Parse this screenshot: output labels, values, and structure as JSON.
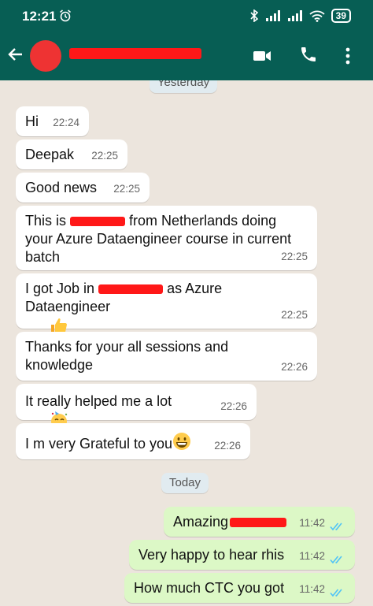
{
  "status_bar": {
    "time": "12:21",
    "battery": "39"
  },
  "header": {
    "contact_name": ""
  },
  "chat": {
    "date_yesterday": "Yesterday",
    "date_today": "Today",
    "messages": [
      {
        "text": "Hi",
        "time": "22:24"
      },
      {
        "text": "Deepak",
        "time": "22:25"
      },
      {
        "text": "Good news",
        "time": "22:25"
      },
      {
        "text_a": "This is",
        "text_b": "from Netherlands doing your Azure Dataengineer course in current batch",
        "time": "22:25"
      },
      {
        "text_a": "I got Job in",
        "text_b": "as Azure Dataengineer",
        "time": "22:25"
      },
      {
        "text": "Thanks for your all sessions and knowledge",
        "time": "22:26"
      },
      {
        "text": "It really helped me a lot",
        "time": "22:26"
      },
      {
        "text": "I m very Grateful to you",
        "time": "22:26"
      },
      {
        "text": "Amazing",
        "time": "11:42"
      },
      {
        "text": "Very happy to hear rhis",
        "time": "11:42"
      },
      {
        "text": "How much CTC you got",
        "time": "11:42"
      }
    ]
  },
  "colors": {
    "header": "#075e54",
    "chat_bg": "#ece5dd",
    "outgoing": "#dcf8c6",
    "incoming": "#ffffff",
    "read_ticks": "#4fc3f7",
    "redaction": "#ff1818"
  },
  "icons": [
    "alarm-icon",
    "bluetooth-icon",
    "signal-icon",
    "wifi-icon",
    "back-arrow-icon",
    "video-call-icon",
    "phone-icon",
    "more-options-icon",
    "thumbs-up-emoji",
    "party-face-emoji",
    "grin-emoji",
    "double-tick-icon"
  ]
}
